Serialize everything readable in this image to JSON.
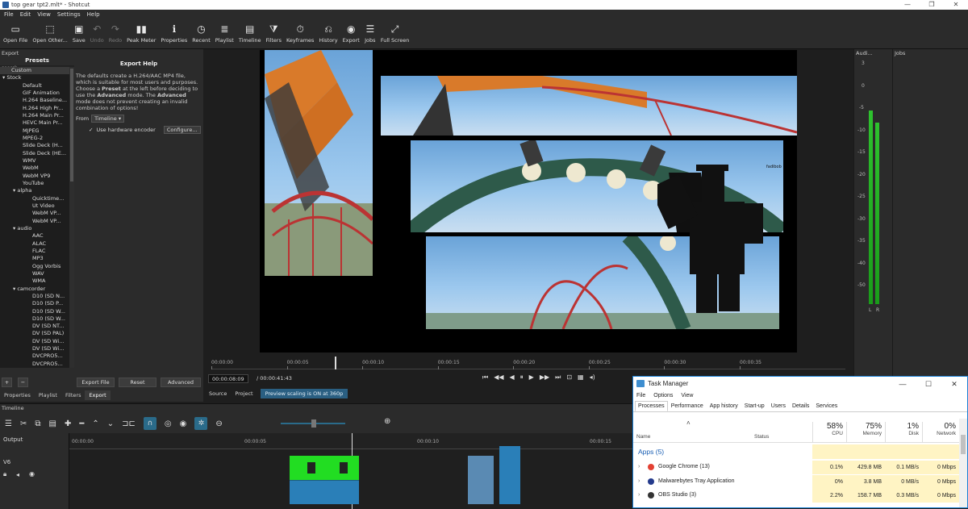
{
  "window": {
    "title": "top gear tpt2.mlt* - Shotcut",
    "controls": [
      "—",
      "❐",
      "✕"
    ]
  },
  "menu": [
    "File",
    "Edit",
    "View",
    "Settings",
    "Help"
  ],
  "toolbar": [
    {
      "label": "Open File",
      "icon": "open-file-icon",
      "glyph": "▭",
      "enabled": true
    },
    {
      "label": "Open Other...",
      "icon": "open-other-icon",
      "glyph": "⬚",
      "enabled": true
    },
    {
      "label": "Save",
      "icon": "save-icon",
      "glyph": "▣",
      "enabled": true
    },
    {
      "label": "Undo",
      "icon": "undo-icon",
      "glyph": "↶",
      "enabled": false
    },
    {
      "label": "Redo",
      "icon": "redo-icon",
      "glyph": "↷",
      "enabled": false
    },
    {
      "label": "Peak Meter",
      "icon": "peak-meter-icon",
      "glyph": "▮▮",
      "enabled": true
    },
    {
      "label": "Properties",
      "icon": "properties-icon",
      "glyph": "ℹ",
      "enabled": true
    },
    {
      "label": "Recent",
      "icon": "recent-icon",
      "glyph": "◷",
      "enabled": true
    },
    {
      "label": "Playlist",
      "icon": "playlist-icon",
      "glyph": "≣",
      "enabled": true
    },
    {
      "label": "Timeline",
      "icon": "timeline-icon",
      "glyph": "▤",
      "enabled": true
    },
    {
      "label": "Filters",
      "icon": "filters-icon",
      "glyph": "⧩",
      "enabled": true
    },
    {
      "label": "Keyframes",
      "icon": "keyframes-icon",
      "glyph": "⏱",
      "enabled": true
    },
    {
      "label": "History",
      "icon": "history-icon",
      "glyph": "⎌",
      "enabled": true
    },
    {
      "label": "Export",
      "icon": "export-icon",
      "glyph": "◉",
      "enabled": true
    },
    {
      "label": "Jobs",
      "icon": "jobs-icon",
      "glyph": "☰",
      "enabled": true
    },
    {
      "label": "Full Screen",
      "icon": "full-screen-icon",
      "glyph": "⤢",
      "enabled": true
    }
  ],
  "export": {
    "panel_title": "Export",
    "presets_header": "Presets",
    "search_placeholder": "search",
    "presets": [
      {
        "t": "Custom",
        "c": "l0"
      },
      {
        "t": "Stock",
        "c": "g0"
      },
      {
        "t": "Default",
        "c": "l1"
      },
      {
        "t": "GIF Animation",
        "c": "l1"
      },
      {
        "t": "H.264 Baseline...",
        "c": "l1"
      },
      {
        "t": "H.264 High Pr...",
        "c": "l1"
      },
      {
        "t": "H.264 Main Pr...",
        "c": "l1"
      },
      {
        "t": "HEVC Main Pr...",
        "c": "l1"
      },
      {
        "t": "MJPEG",
        "c": "l1"
      },
      {
        "t": "MPEG-2",
        "c": "l1"
      },
      {
        "t": "Slide Deck (H...",
        "c": "l1"
      },
      {
        "t": "Slide Deck (HE...",
        "c": "l1"
      },
      {
        "t": "WMV",
        "c": "l1"
      },
      {
        "t": "WebM",
        "c": "l1"
      },
      {
        "t": "WebM VP9",
        "c": "l1"
      },
      {
        "t": "YouTube",
        "c": "l1"
      },
      {
        "t": "alpha",
        "c": "g1"
      },
      {
        "t": "Quicktime...",
        "c": "l2"
      },
      {
        "t": "Ut Video",
        "c": "l2"
      },
      {
        "t": "WebM VP...",
        "c": "l2"
      },
      {
        "t": "WebM VP...",
        "c": "l2"
      },
      {
        "t": "audio",
        "c": "g1"
      },
      {
        "t": "AAC",
        "c": "l2"
      },
      {
        "t": "ALAC",
        "c": "l2"
      },
      {
        "t": "FLAC",
        "c": "l2"
      },
      {
        "t": "MP3",
        "c": "l2"
      },
      {
        "t": "Ogg Vorbis",
        "c": "l2"
      },
      {
        "t": "WAV",
        "c": "l2"
      },
      {
        "t": "WMA",
        "c": "l2"
      },
      {
        "t": "camcorder",
        "c": "g1"
      },
      {
        "t": "D10 (SD N...",
        "c": "l2"
      },
      {
        "t": "D10 (SD P...",
        "c": "l2"
      },
      {
        "t": "D10 (SD W...",
        "c": "l2"
      },
      {
        "t": "D10 (SD W...",
        "c": "l2"
      },
      {
        "t": "DV (SD NT...",
        "c": "l2"
      },
      {
        "t": "DV (SD PAL)",
        "c": "l2"
      },
      {
        "t": "DV (SD Wi...",
        "c": "l2"
      },
      {
        "t": "DV (SD Wi...",
        "c": "l2"
      },
      {
        "t": "DVCPRO5...",
        "c": "l2"
      },
      {
        "t": "DVCPRO5...",
        "c": "l2"
      }
    ],
    "help_title": "Export Help",
    "help_text_1": "The defaults create a H.264/AAC MP4 file, which is suitable for most users and purposes. Choose a ",
    "help_bold_1": "Preset",
    "help_text_2": " at the left before deciding to use the ",
    "help_bold_2": "Advanced",
    "help_text_3": " mode. The ",
    "help_bold_3": "Advanced",
    "help_text_4": " mode does not prevent creating an invalid combination of options!",
    "from_label": "From",
    "from_value": "Timeline",
    "hw_encoder_label": "Use hardware encoder",
    "hw_encoder_checked": true,
    "configure_label": "Configure...",
    "add_label": "+",
    "remove_label": "−",
    "export_file_label": "Export File",
    "reset_label": "Reset",
    "advanced_label": "Advanced",
    "tabs": [
      "Properties",
      "Playlist",
      "Filters",
      "Export"
    ],
    "active_tab": "Export"
  },
  "player": {
    "ruler": [
      "00:00:00",
      "00:00:05",
      "00:00:10",
      "00:00:15",
      "00:00:20",
      "00:00:25",
      "00:00:30",
      "00:00:35"
    ],
    "playhead_position": 0.195,
    "timecode": "00:00:08:09",
    "duration": "/ 00:00:41:43",
    "source_tab": "Source",
    "project_tab": "Project",
    "scaling_text": "Preview scaling is ON at 360p",
    "controls": [
      "⏮",
      "◀◀",
      "◀",
      "⏸",
      "▶",
      "▶▶",
      "⏭"
    ],
    "video_label": "fadibob"
  },
  "audio_meter": {
    "title": "Audi...",
    "scale": [
      "3",
      "0",
      "-5",
      "-10",
      "-15",
      "-20",
      "-25",
      "-30",
      "-35",
      "-40",
      "-50"
    ],
    "left_label": "L",
    "right_label": "R",
    "left_level": 0.81,
    "right_level": 0.76
  },
  "jobs": {
    "title": "Jobs"
  },
  "timeline": {
    "title": "Timeline",
    "output_label": "Output",
    "track_label": "V6",
    "ruler": [
      "00:00:00",
      "00:00:05",
      "00:00:10",
      "00:00:15"
    ]
  },
  "taskmanager": {
    "title": "Task Manager",
    "controls": [
      "—",
      "☐",
      "✕"
    ],
    "menu": [
      "File",
      "Options",
      "View"
    ],
    "tabs": [
      "Processes",
      "Performance",
      "App history",
      "Start-up",
      "Users",
      "Details",
      "Services"
    ],
    "active_tab": "Processes",
    "headers": {
      "name": "Name",
      "status": "Status",
      "cpu_pct": "58%",
      "cpu": "CPU",
      "mem_pct": "75%",
      "mem": "Memory",
      "disk_pct": "1%",
      "disk": "Disk",
      "net_pct": "0%",
      "net": "Network"
    },
    "group": "Apps (5)",
    "rows": [
      {
        "name": "Google Chrome (13)",
        "cpu": "0.1%",
        "mem": "429.8 MB",
        "disk": "0.1 MB/s",
        "net": "0 Mbps",
        "icon": "chrome-icon",
        "color": "#e34133"
      },
      {
        "name": "Malwarebytes Tray Application",
        "cpu": "0%",
        "mem": "3.8 MB",
        "disk": "0 MB/s",
        "net": "0 Mbps",
        "icon": "malwarebytes-icon",
        "color": "#243a8c"
      },
      {
        "name": "OBS Studio (3)",
        "cpu": "2.2%",
        "mem": "158.7 MB",
        "disk": "0.3 MB/s",
        "net": "0 Mbps",
        "icon": "obs-icon",
        "color": "#333333"
      }
    ]
  },
  "colors": {
    "accent": "#2a6b8a",
    "meter_green": "#2ec22e",
    "clip_green": "#22dd22",
    "clip_blue": "#2a7fb8",
    "task_manager_border": "#1a7fd4"
  }
}
